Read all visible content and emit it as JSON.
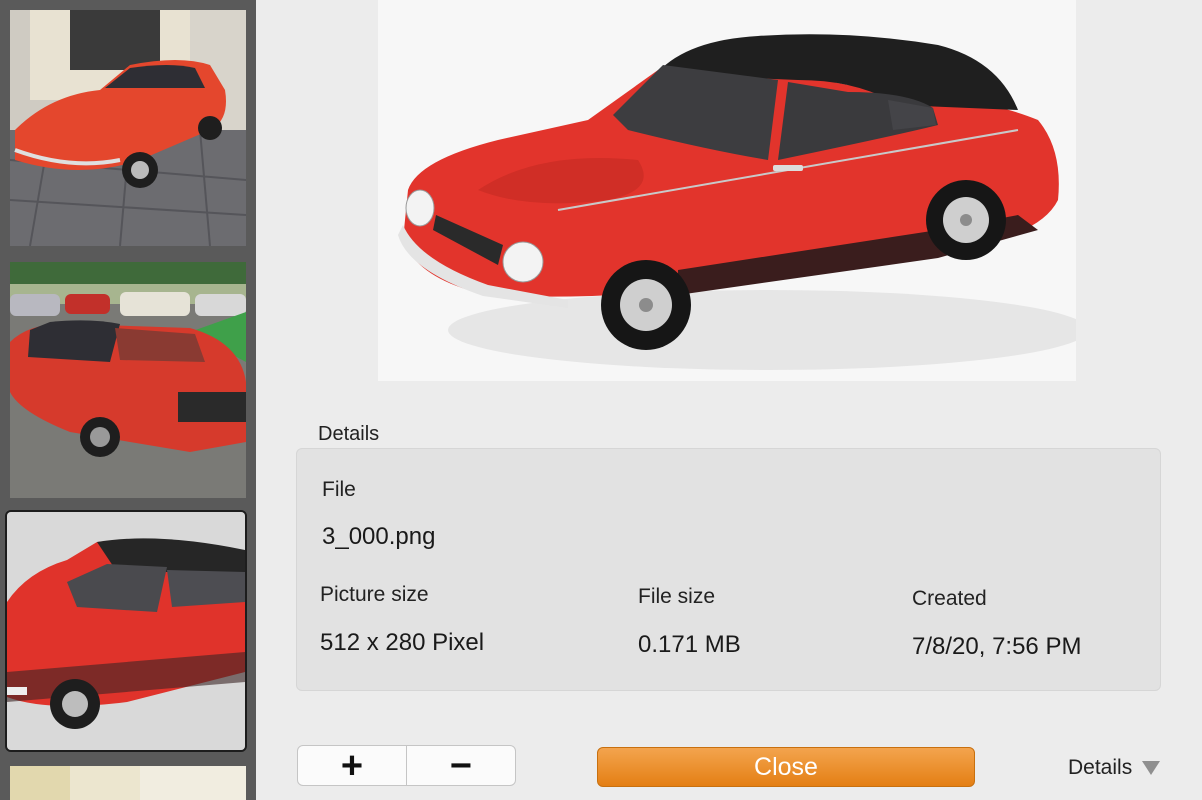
{
  "thumbnails": [
    {
      "name": "thumbnail-red-coupe-front-parked"
    },
    {
      "name": "thumbnail-red-coupe-rear-show"
    },
    {
      "name": "thumbnail-red-coupe-model",
      "selected": true
    },
    {
      "name": "thumbnail-building-partial"
    }
  ],
  "details": {
    "heading": "Details",
    "file_label": "File",
    "file_value": "3_000.png",
    "picture_size_label": "Picture size",
    "picture_size_value": "512 x 280 Pixel",
    "file_size_label": "File size",
    "file_size_value": "0.171 MB",
    "created_label": "Created",
    "created_value": "7/8/20, 7:56 PM"
  },
  "controls": {
    "plus_label": "+",
    "minus_label": "−",
    "close_label": "Close",
    "details_toggle_label": "Details"
  },
  "colors": {
    "accent": "#e8861f",
    "sidebar": "#5a5a5a",
    "car_red": "#e0332b"
  }
}
